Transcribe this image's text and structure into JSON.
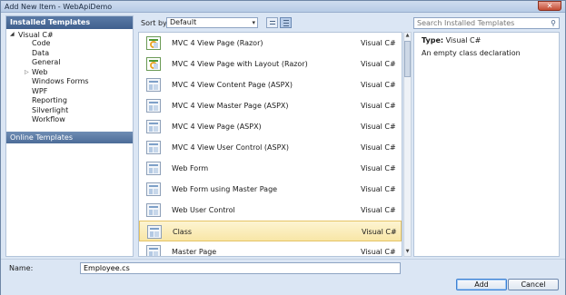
{
  "window": {
    "title": "Add New Item - WebApiDemo",
    "close_glyph": "✕"
  },
  "left": {
    "header": "Installed Templates",
    "root": {
      "label": "Visual C#",
      "expander": "◢"
    },
    "items": [
      {
        "label": "Code",
        "expander": ""
      },
      {
        "label": "Data",
        "expander": ""
      },
      {
        "label": "General",
        "expander": ""
      },
      {
        "label": "Web",
        "expander": "▷"
      },
      {
        "label": "Windows Forms",
        "expander": ""
      },
      {
        "label": "WPF",
        "expander": ""
      },
      {
        "label": "Reporting",
        "expander": ""
      },
      {
        "label": "Silverlight",
        "expander": ""
      },
      {
        "label": "Workflow",
        "expander": ""
      }
    ],
    "online": "Online Templates"
  },
  "sort": {
    "label": "Sort by:",
    "value": "Default",
    "arrow": "▾"
  },
  "templates": [
    {
      "name": "MVC 4 View Page (Razor)",
      "lang": "Visual C#",
      "icon": "mvc-razor-icon"
    },
    {
      "name": "MVC 4 View Page with Layout (Razor)",
      "lang": "Visual C#",
      "icon": "mvc-razor-icon"
    },
    {
      "name": "MVC 4 View Content Page (ASPX)",
      "lang": "Visual C#",
      "icon": "aspx-page-icon"
    },
    {
      "name": "MVC 4 View Master Page (ASPX)",
      "lang": "Visual C#",
      "icon": "master-page-icon"
    },
    {
      "name": "MVC 4 View Page (ASPX)",
      "lang": "Visual C#",
      "icon": "aspx-page-icon"
    },
    {
      "name": "MVC 4 View User Control (ASPX)",
      "lang": "Visual C#",
      "icon": "user-control-icon"
    },
    {
      "name": "Web Form",
      "lang": "Visual C#",
      "icon": "web-form-icon"
    },
    {
      "name": "Web Form using Master Page",
      "lang": "Visual C#",
      "icon": "web-form-icon"
    },
    {
      "name": "Web User Control",
      "lang": "Visual C#",
      "icon": "user-control-icon"
    },
    {
      "name": "Class",
      "lang": "Visual C#",
      "icon": "class-icon",
      "selected": true
    },
    {
      "name": "Master Page",
      "lang": "Visual C#",
      "icon": "master-page-icon"
    }
  ],
  "search": {
    "placeholder": "Search Installed Templates",
    "icon": "search-icon"
  },
  "details": {
    "type_label": "Type:",
    "type_value": "Visual C#",
    "description": "An empty class declaration"
  },
  "bottom": {
    "name_label": "Name:",
    "name_value": "Employee.cs",
    "add_label": "Add",
    "cancel_label": "Cancel"
  },
  "colors": {
    "selected_bg": "#f8e6a6",
    "header_bg": "#3f5f8d",
    "accent": "#3c7fd1"
  }
}
